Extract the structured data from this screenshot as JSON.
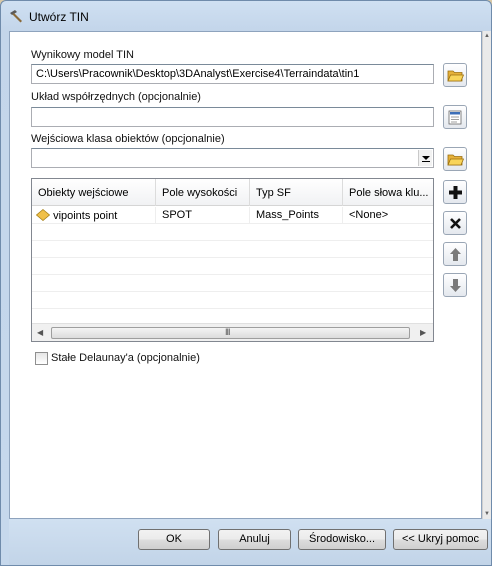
{
  "window": {
    "title": "Utwórz TIN"
  },
  "form": {
    "output_tin": {
      "label": "Wynikowy model TIN",
      "value": "C:\\Users\\Pracownik\\Desktop\\3DAnalyst\\Exercise4\\Terraindata\\tin1"
    },
    "coordinate_system": {
      "label": "Układ współrzędnych (opcjonalnie)",
      "value": ""
    },
    "input_feature_class": {
      "label": "Wejściowa klasa obiektów (opcjonalnie)",
      "value": ""
    },
    "table": {
      "headers": [
        "Obiekty wejściowe",
        "Pole wysokości",
        "Typ SF",
        "Pole słowa klu..."
      ],
      "rows": [
        [
          "vipoints point",
          "SPOT",
          "Mass_Points",
          "<None>"
        ]
      ],
      "scroll_grip": "III"
    },
    "delaunay": {
      "label": "Stałe Delaunay'a (opcjonalnie)",
      "checked": false
    }
  },
  "icons": {
    "title": "hammer-icon",
    "browse": "open-folder-icon",
    "spatial_reference": "spatial-reference-icon",
    "add": "plus-icon",
    "remove": "x-icon",
    "up": "arrow-up-icon",
    "down": "arrow-down-icon",
    "layer": "point-layer-icon"
  },
  "buttons": {
    "ok": "OK",
    "cancel": "Anuluj",
    "environments": "Środowisko...",
    "hide_help": "<< Ukryj pomoc"
  },
  "colors": {
    "frame": "#c6d8ec",
    "folder": "#f3c545",
    "arrow_gray": "#7a7a7a"
  }
}
